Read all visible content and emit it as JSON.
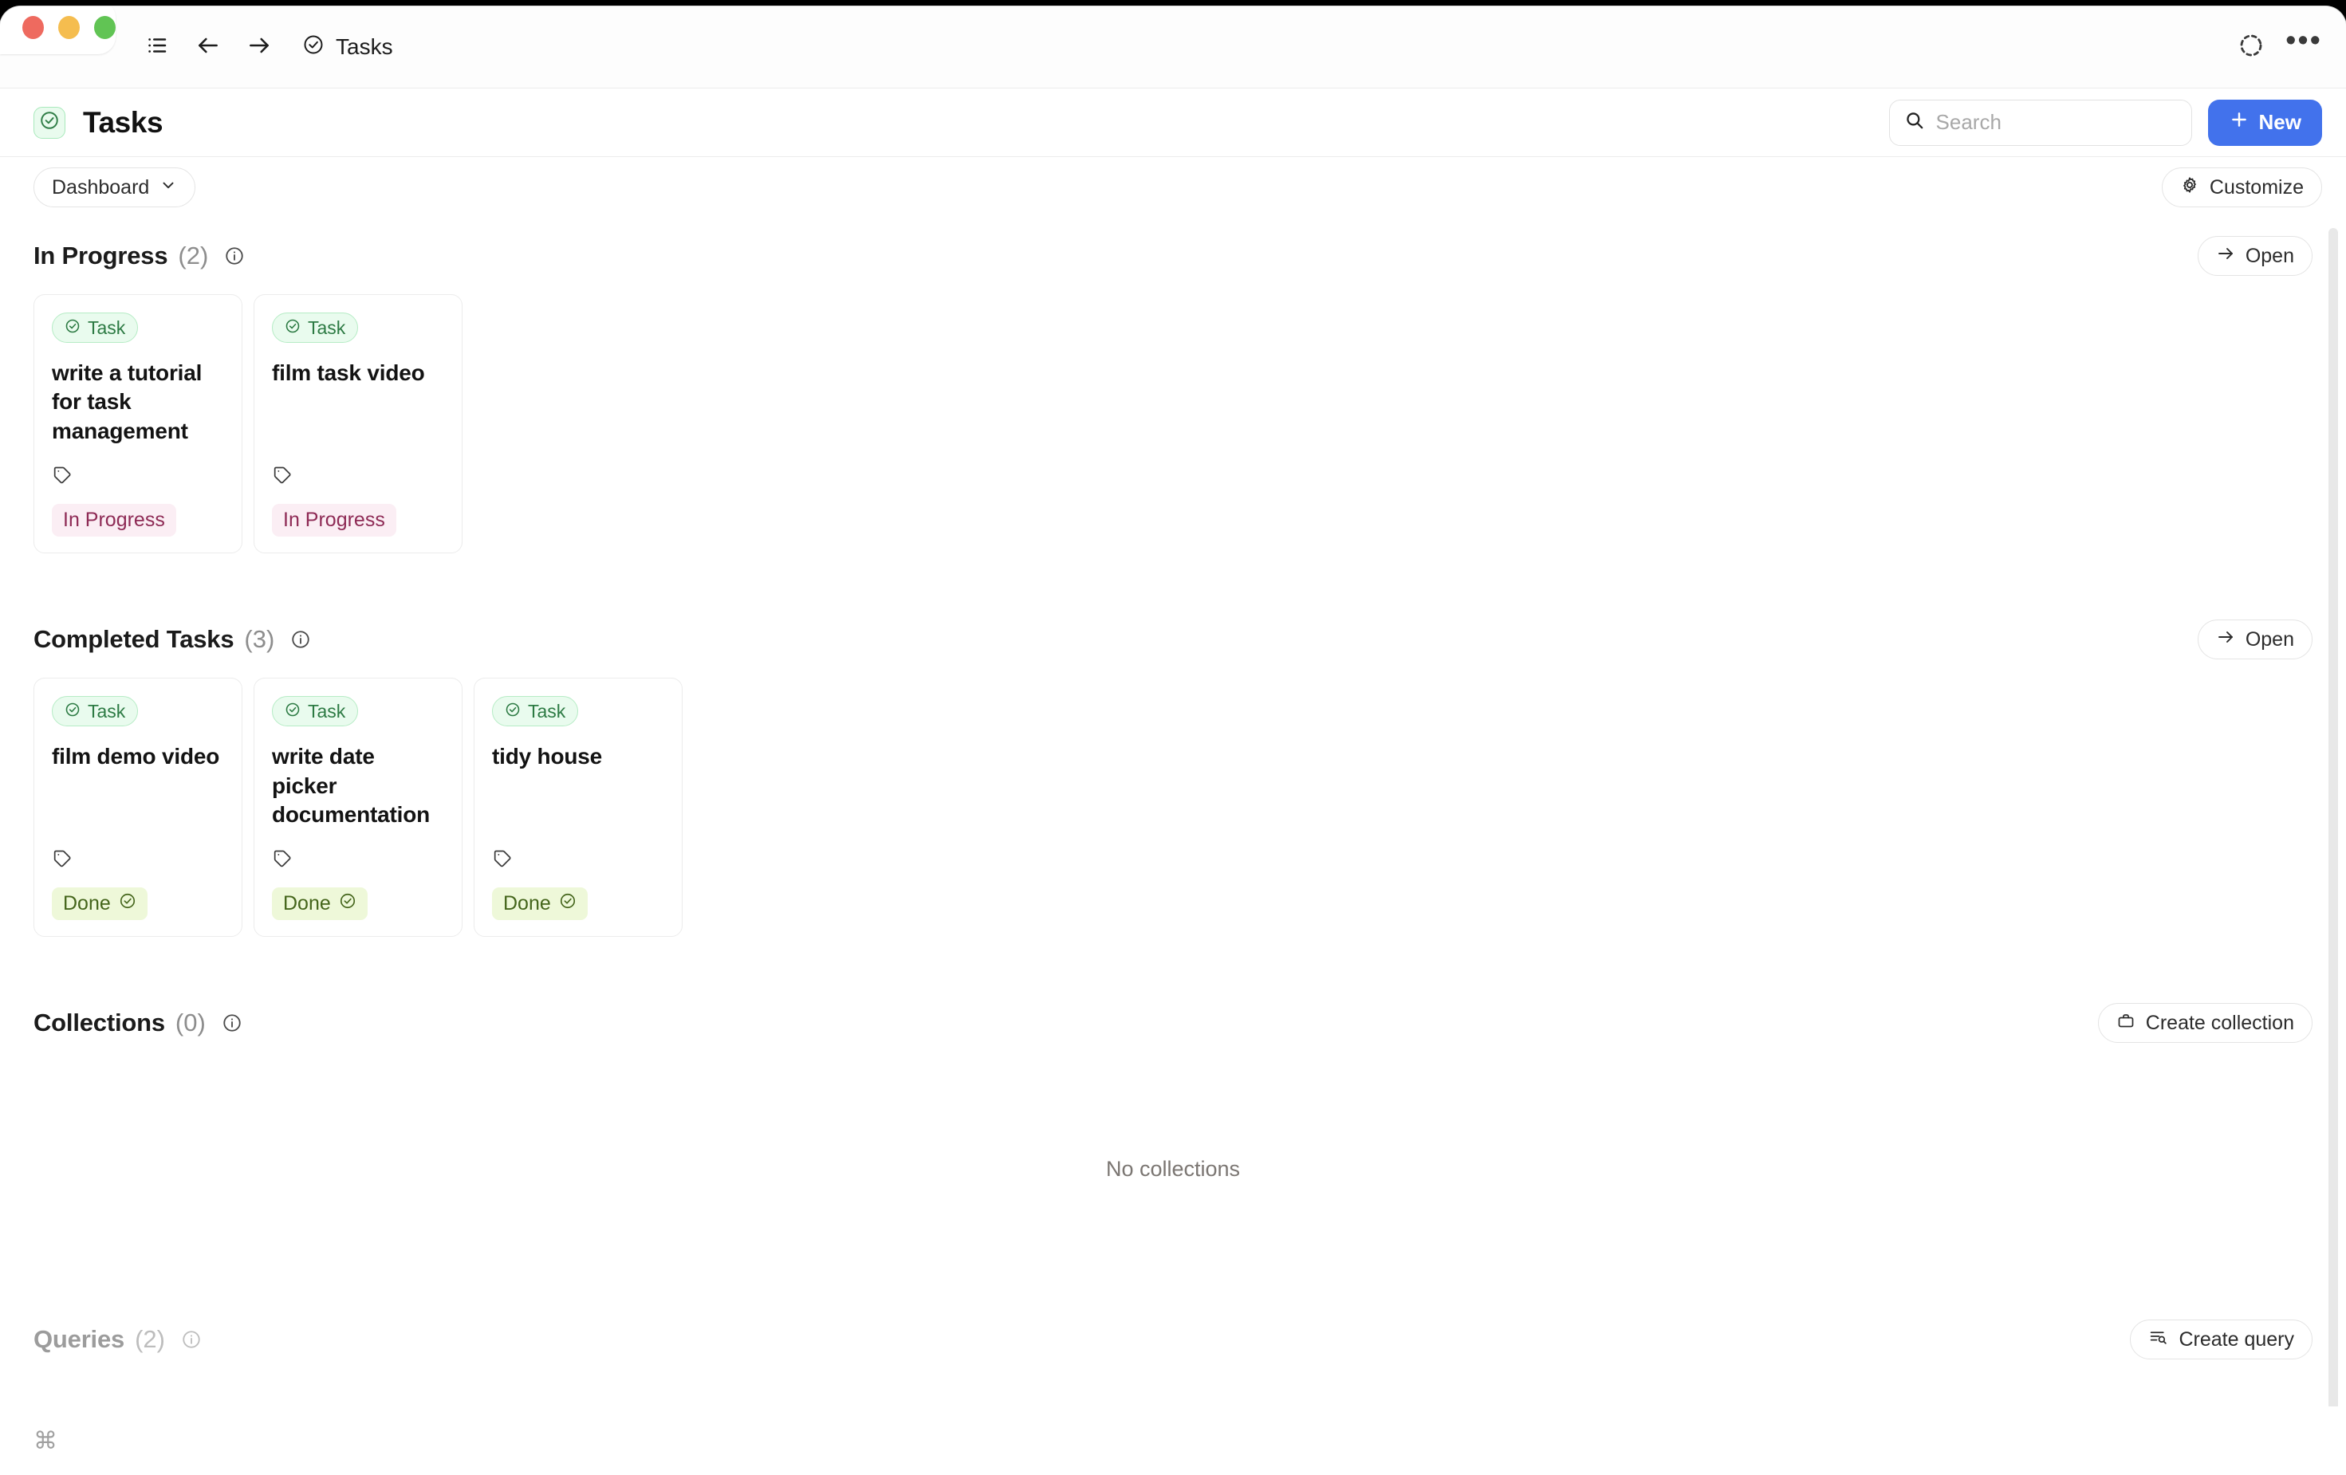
{
  "window": {
    "traffic_lights": [
      "close",
      "minimize",
      "maximize"
    ],
    "titlebar": {
      "sidebar_toggle_icon": "list-sidebar-icon",
      "back_icon": "arrow-left-icon",
      "forward_icon": "arrow-right-icon",
      "doc_icon": "check-circle-icon",
      "doc_title": "Tasks",
      "sync_icon": "dashed-circle-icon",
      "more_label": "•••"
    }
  },
  "header": {
    "icon": "check-circle-icon",
    "title": "Tasks",
    "search": {
      "icon": "search-icon",
      "value": "",
      "placeholder": "Search"
    },
    "new_button": {
      "icon": "plus-icon",
      "label": "New"
    }
  },
  "toolbar": {
    "view_selector": {
      "label": "Dashboard",
      "icon": "chevron-down-icon"
    },
    "customize": {
      "label": "Customize",
      "icon": "gear-icon"
    }
  },
  "sections": [
    {
      "title": "In Progress",
      "count": "(2)",
      "info_icon": "info-circle-icon",
      "action": {
        "label": "Open",
        "icon": "arrow-right-icon"
      },
      "cards": [
        {
          "type_label": "Task",
          "type_icon": "check-circle-icon",
          "title": "write a tutorial for task management",
          "tag_icon": "tag-icon",
          "status": "In Progress",
          "status_icon": "",
          "status_style": "status-inprogress"
        },
        {
          "type_label": "Task",
          "type_icon": "check-circle-icon",
          "title": "film task video",
          "tag_icon": "tag-icon",
          "status": "In Progress",
          "status_icon": "",
          "status_style": "status-inprogress"
        }
      ]
    },
    {
      "title": "Completed Tasks",
      "count": "(3)",
      "info_icon": "info-circle-icon",
      "action": {
        "label": "Open",
        "icon": "arrow-right-icon"
      },
      "cards": [
        {
          "type_label": "Task",
          "type_icon": "check-circle-icon",
          "title": "film demo video",
          "tag_icon": "tag-icon",
          "status": "Done",
          "status_icon": "check-circle-icon",
          "status_style": "status-done"
        },
        {
          "type_label": "Task",
          "type_icon": "check-circle-icon",
          "title": "write date picker documentation",
          "tag_icon": "tag-icon",
          "status": "Done",
          "status_icon": "check-circle-icon",
          "status_style": "status-done"
        },
        {
          "type_label": "Task",
          "type_icon": "check-circle-icon",
          "title": "tidy house",
          "tag_icon": "tag-icon",
          "status": "Done",
          "status_icon": "check-circle-icon",
          "status_style": "status-done"
        }
      ]
    },
    {
      "title": "Collections",
      "count": "(0)",
      "info_icon": "info-circle-icon",
      "action": {
        "label": "Create collection",
        "icon": "collection-icon"
      },
      "empty_text": "No collections",
      "cards": []
    },
    {
      "title": "Queries",
      "count": "(2)",
      "info_icon": "info-circle-icon",
      "muted": true,
      "action": {
        "label": "Create query",
        "icon": "query-icon"
      },
      "cards": []
    }
  ],
  "footer": {
    "cmd_glyph": "⌘"
  },
  "colors": {
    "accent_blue": "#4272ec",
    "task_pill_bg": "#e9fbee",
    "task_pill_text": "#2c7a43",
    "in_progress_bg": "#fbeef4",
    "in_progress_text": "#8e2a55",
    "done_bg": "#eef8d9",
    "done_text": "#44651b"
  }
}
